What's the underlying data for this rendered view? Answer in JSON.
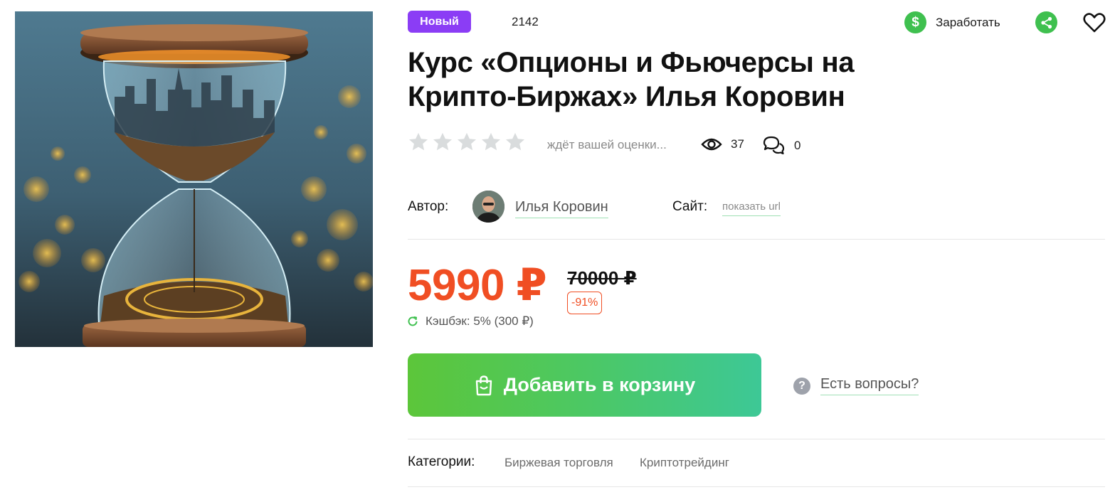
{
  "badge": {
    "label": "Новый"
  },
  "product": {
    "id": "2142",
    "title_line1": "Курс «Опционы и Фьючерсы на",
    "title_line2": "Крипто-Биржах» Илья Коровин"
  },
  "actions": {
    "earn_label": "Заработать",
    "earn_symbol": "$"
  },
  "rating": {
    "stars_filled": 0,
    "stars_total": 5,
    "text": "ждёт вашей оценки...",
    "views": "37",
    "comments": "0"
  },
  "author": {
    "label": "Автор:",
    "name": "Илья Коровин",
    "site_label": "Сайт:",
    "site_link": "показать url"
  },
  "pricing": {
    "price": "5990 ₽",
    "old_price": "70000 ₽",
    "discount": "-91%",
    "cashback": "Кэшбэк: 5% (300 ₽)"
  },
  "cart": {
    "button_label": "Добавить в корзину"
  },
  "help": {
    "icon": "?",
    "label": "Есть вопросы?"
  },
  "categories": {
    "label": "Категории:",
    "items": [
      "Биржевая торговля",
      "Криптотрейдинг"
    ]
  },
  "colors": {
    "accent_purple": "#8b3df5",
    "price_red": "#f04e23",
    "green": "#3fc04f"
  }
}
